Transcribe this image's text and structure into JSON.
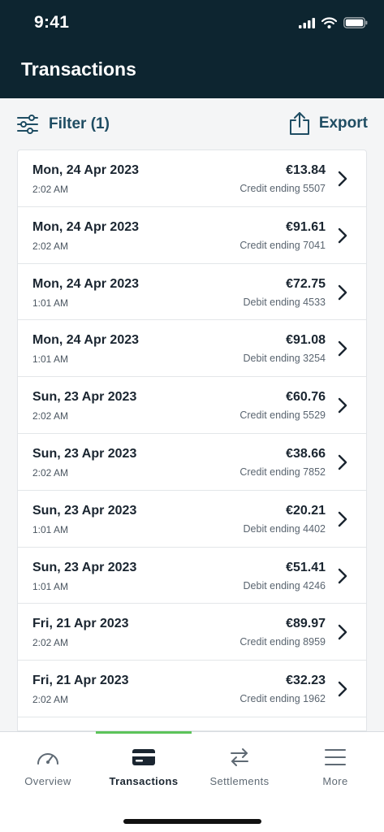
{
  "status_bar": {
    "time": "9:41"
  },
  "header": {
    "title": "Transactions"
  },
  "toolbar": {
    "filter_label": "Filter (1)",
    "export_label": "Export"
  },
  "transactions": [
    {
      "date": "Mon, 24 Apr 2023",
      "time": "2:02 AM",
      "amount": "€13.84",
      "card": "Credit ending 5507"
    },
    {
      "date": "Mon, 24 Apr 2023",
      "time": "2:02 AM",
      "amount": "€91.61",
      "card": "Credit ending 7041"
    },
    {
      "date": "Mon, 24 Apr 2023",
      "time": "1:01 AM",
      "amount": "€72.75",
      "card": "Debit ending 4533"
    },
    {
      "date": "Mon, 24 Apr 2023",
      "time": "1:01 AM",
      "amount": "€91.08",
      "card": "Debit ending 3254"
    },
    {
      "date": "Sun, 23 Apr 2023",
      "time": "2:02 AM",
      "amount": "€60.76",
      "card": "Credit ending 5529"
    },
    {
      "date": "Sun, 23 Apr 2023",
      "time": "2:02 AM",
      "amount": "€38.66",
      "card": "Credit ending 7852"
    },
    {
      "date": "Sun, 23 Apr 2023",
      "time": "1:01 AM",
      "amount": "€20.21",
      "card": "Debit ending 4402"
    },
    {
      "date": "Sun, 23 Apr 2023",
      "time": "1:01 AM",
      "amount": "€51.41",
      "card": "Debit ending 4246"
    },
    {
      "date": "Fri, 21 Apr 2023",
      "time": "2:02 AM",
      "amount": "€89.97",
      "card": "Credit ending 8959"
    },
    {
      "date": "Fri, 21 Apr 2023",
      "time": "2:02 AM",
      "amount": "€32.23",
      "card": "Credit ending 1962"
    }
  ],
  "tabs": [
    {
      "label": "Overview",
      "icon": "speedometer-icon",
      "active": false
    },
    {
      "label": "Transactions",
      "icon": "credit-card-icon",
      "active": true
    },
    {
      "label": "Settlements",
      "icon": "swap-arrows-icon",
      "active": false
    },
    {
      "label": "More",
      "icon": "menu-icon",
      "active": false
    }
  ],
  "colors": {
    "header_bg": "#0d2530",
    "accent_text": "#1f4d63",
    "active_tab_indicator": "#5cc35a"
  }
}
